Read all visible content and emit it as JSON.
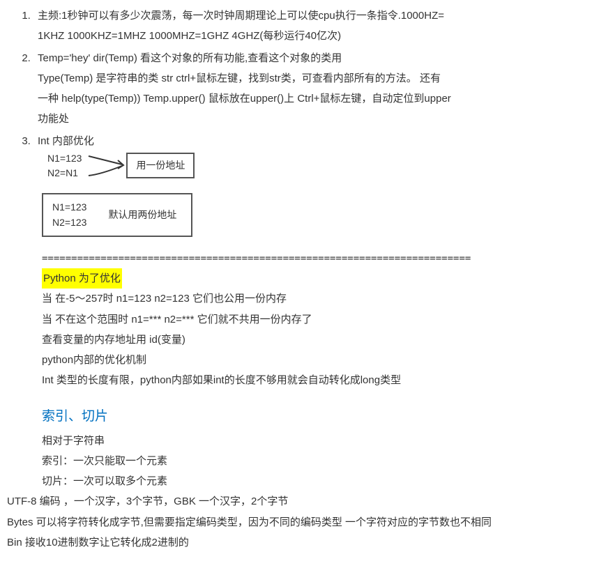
{
  "item1": {
    "line1": "主频:1秒钟可以有多少次震荡，每一次时钟周期理论上可以使cpu执行一条指令.1000HZ=",
    "line2": "1KHZ   1000KHZ=1MHZ   1000MHZ=1GHZ 4GHZ(每秒运行40亿次)"
  },
  "item2": {
    "line1": "Temp='hey'    dir(Temp)   看这个对象的所有功能,查看这个对象的类用",
    "line2": "Type(Temp)    是字符串的类   str   ctrl+鼠标左键，找到str类，可查看内部所有的方法。 还有",
    "line3": "一种 help(type(Temp))    Temp.upper() 鼠标放在upper()上  Ctrl+鼠标左键，自动定位到upper",
    "line4": "功能处"
  },
  "item3": {
    "title": "Int 内部优化",
    "box1": {
      "code1": "N1=123",
      "code2": "N2=N1",
      "label": "用一份地址"
    },
    "box2": {
      "code1": "N1=123",
      "code2": "N2=123",
      "label": "默认用两份地址"
    }
  },
  "divider": "=========================================================================",
  "opt": {
    "title": "Python 为了优化",
    "line1": "当 在-5～257时   n1=123 n2=123  它们也公用一份内存",
    "line2": "当  不在这个范围时   n1=*** n2=*** 它们就不共用一份内存了",
    "line3": "查看变量的内存地址用    id(变量)",
    "line4": "python内部的优化机制",
    "line5": "Int 类型的长度有限，python内部如果int的长度不够用就会自动转化成long类型"
  },
  "heading": "索引、切片",
  "slice": {
    "line1": "相对于字符串",
    "line2": "索引：一次只能取一个元素",
    "line3": "切片：一次可以取多个元素"
  },
  "tail": {
    "line1": "UTF-8 编码  ，一个汉字，3个字节，GBK 一个汉字，2个字节",
    "line2": "Bytes 可以将字符转化成字节,但需要指定编码类型，因为不同的编码类型  一个字符对应的字节数也不相同",
    "line3": "Bin 接收10进制数字让它转化成2进制的"
  }
}
